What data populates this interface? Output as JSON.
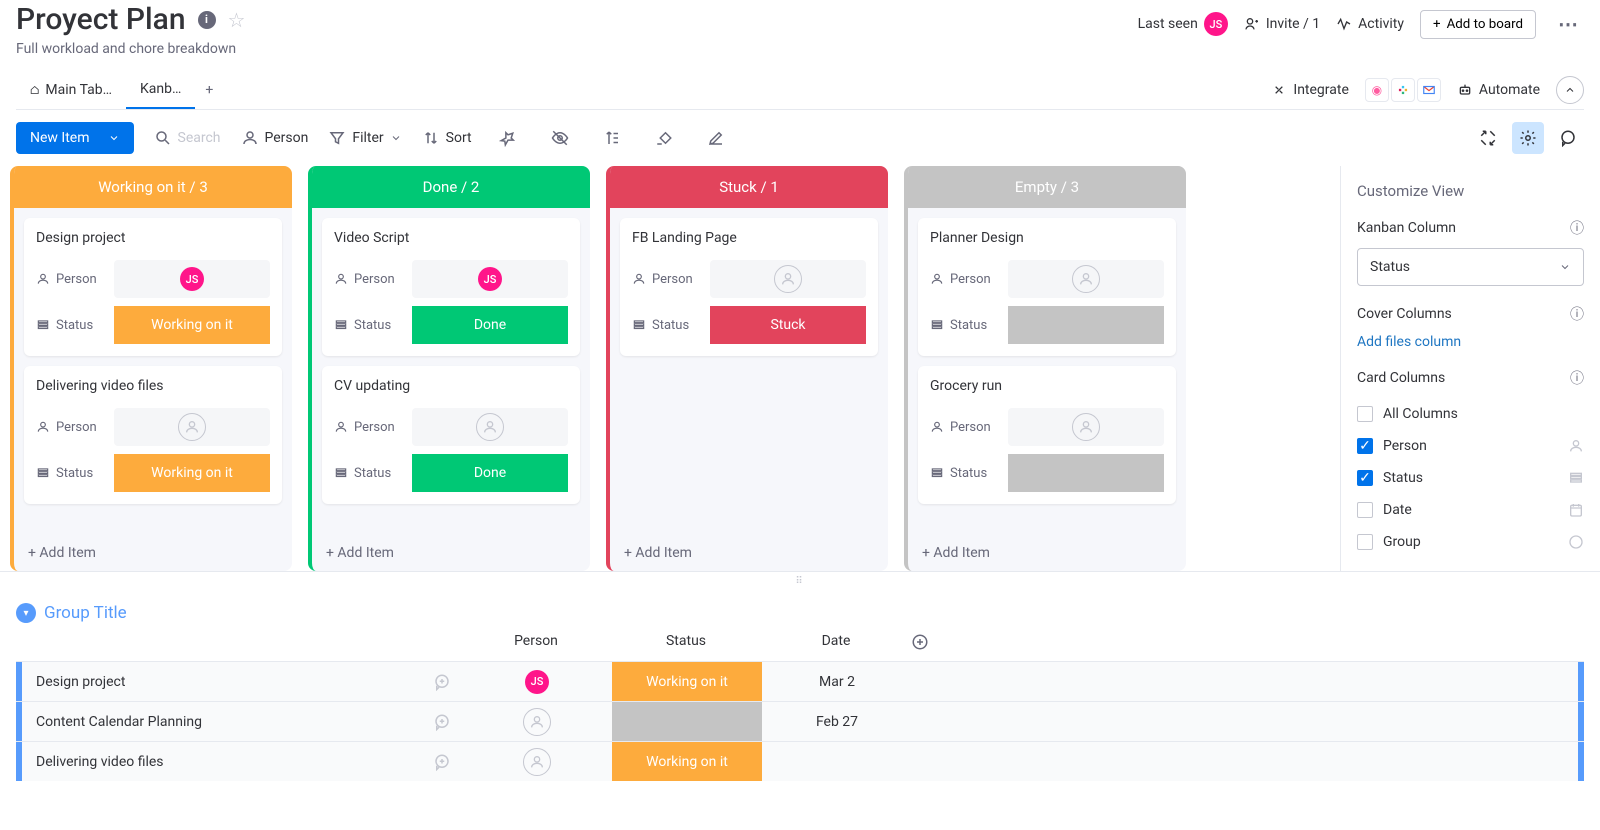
{
  "header": {
    "title": "Proyect Plan",
    "subtitle": "Full workload and chore breakdown",
    "last_seen_label": "Last seen",
    "last_seen_initials": "JS",
    "invite_label": "Invite / 1",
    "activity_label": "Activity",
    "add_to_board_label": "Add to board"
  },
  "tabs": {
    "main": "Main Tab…",
    "kanban": "Kanb…",
    "integrate_label": "Integrate",
    "automate_label": "Automate"
  },
  "toolbar": {
    "new_item": "New Item",
    "search_placeholder": "Search",
    "person": "Person",
    "filter": "Filter",
    "sort": "Sort"
  },
  "kanban": {
    "columns": [
      {
        "key": "working",
        "color": "orange",
        "header": "Working on it / 3"
      },
      {
        "key": "done",
        "color": "green",
        "header": "Done / 2"
      },
      {
        "key": "stuck",
        "color": "red",
        "header": "Stuck / 1"
      },
      {
        "key": "empty",
        "color": "gray",
        "header": "Empty / 3"
      }
    ],
    "add_item_label": "+ Add Item",
    "person_label": "Person",
    "status_label": "Status",
    "cards": {
      "working": [
        {
          "title": "Design project",
          "person": "JS",
          "status": "Working on it",
          "status_color": "orange"
        },
        {
          "title": "Delivering video files",
          "person": "",
          "status": "Working on it",
          "status_color": "orange"
        }
      ],
      "done": [
        {
          "title": "Video Script",
          "person": "JS",
          "status": "Done",
          "status_color": "green"
        },
        {
          "title": "CV updating",
          "person": "",
          "status": "Done",
          "status_color": "green"
        }
      ],
      "stuck": [
        {
          "title": "FB Landing Page",
          "person": "",
          "status": "Stuck",
          "status_color": "red"
        }
      ],
      "empty": [
        {
          "title": "Planner Design",
          "person": "",
          "status": "",
          "status_color": "gray"
        },
        {
          "title": "Grocery run",
          "person": "",
          "status": "",
          "status_color": "gray"
        }
      ]
    }
  },
  "side": {
    "title": "Customize View",
    "kanban_col_label": "Kanban Column",
    "kanban_col_value": "Status",
    "cover_label": "Cover Columns",
    "add_files_link": "Add files column",
    "card_cols_label": "Card Columns",
    "options": [
      {
        "label": "All Columns",
        "checked": false,
        "icon": ""
      },
      {
        "label": "Person",
        "checked": true,
        "icon": "person"
      },
      {
        "label": "Status",
        "checked": true,
        "icon": "status"
      },
      {
        "label": "Date",
        "checked": false,
        "icon": "date"
      },
      {
        "label": "Group",
        "checked": false,
        "icon": "group"
      }
    ]
  },
  "table": {
    "group_title": "Group Title",
    "headers": {
      "person": "Person",
      "status": "Status",
      "date": "Date"
    },
    "rows": [
      {
        "name": "Design project",
        "person": "JS",
        "status": "Working on it",
        "status_color": "orange",
        "date": "Mar 2"
      },
      {
        "name": "Content Calendar Planning",
        "person": "",
        "status": "",
        "status_color": "gray",
        "date": "Feb 27"
      },
      {
        "name": "Delivering video files",
        "person": "",
        "status": "Working on it",
        "status_color": "orange",
        "date": ""
      }
    ]
  }
}
